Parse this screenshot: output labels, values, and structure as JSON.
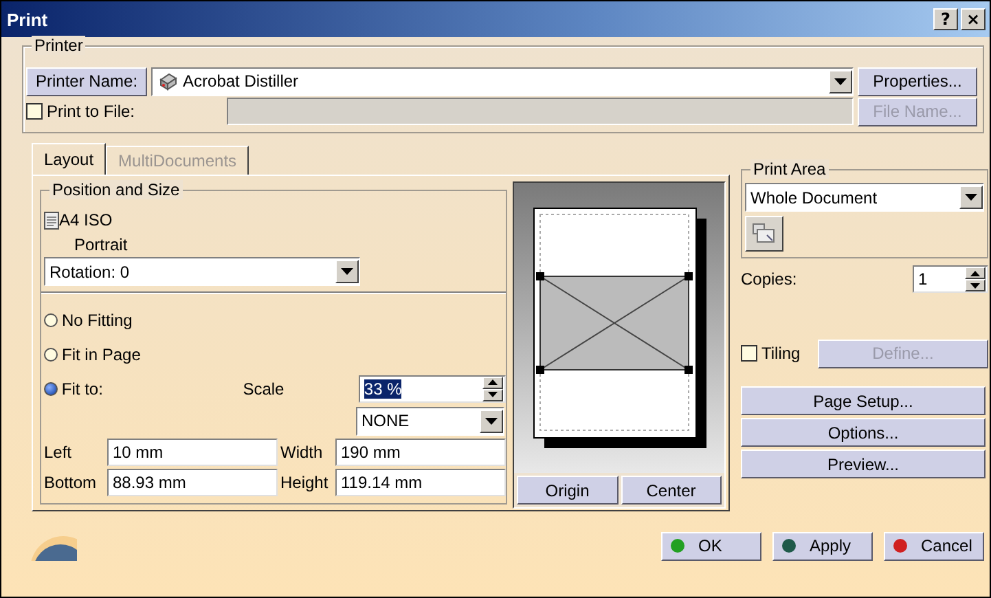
{
  "window": {
    "title": "Print",
    "help": "?",
    "close": "×"
  },
  "printer": {
    "legend": "Printer",
    "name_button": "Printer Name:",
    "printer": "Acrobat Distiller",
    "properties_button": "Properties...",
    "print_to_file": {
      "label": "Print to File:",
      "checked": false
    },
    "file_name_button": {
      "label": "File Name...",
      "disabled": true
    }
  },
  "tabs": [
    {
      "label": "Layout",
      "selected": true
    },
    {
      "label": "MultiDocuments",
      "selected": false
    }
  ],
  "position_and_size": {
    "legend": "Position and Size",
    "paper": "A4 ISO",
    "orientation": "Portrait",
    "rotation": "Rotation: 0",
    "fitting": [
      {
        "label": "No Fitting",
        "selected": false
      },
      {
        "label": "Fit in Page",
        "selected": false
      },
      {
        "label": "Fit to:",
        "selected": true
      }
    ],
    "scale_label": "Scale",
    "scale": "33 %",
    "scale_unit": "NONE",
    "fields": [
      {
        "label": "Left",
        "value": "10 mm"
      },
      {
        "label": "Width",
        "value": "190 mm"
      },
      {
        "label": "Bottom",
        "value": "88.93 mm"
      },
      {
        "label": "Height",
        "value": "119.14 mm"
      }
    ]
  },
  "preview": {
    "buttons": [
      "Origin",
      "Center"
    ]
  },
  "print_area": {
    "legend": "Print Area",
    "value": "Whole Document"
  },
  "copies": {
    "label": "Copies:",
    "value": "1"
  },
  "tiling": {
    "label": "Tiling",
    "checked": false
  },
  "define_button": {
    "label": "Define...",
    "disabled": true
  },
  "side_buttons": [
    "Page Setup...",
    "Options...",
    "Preview..."
  ],
  "footer_buttons": [
    {
      "label": "OK",
      "color": "#22a022"
    },
    {
      "label": "Apply",
      "color": "#1f5a4a"
    },
    {
      "label": "Cancel",
      "color": "#d02020"
    }
  ]
}
